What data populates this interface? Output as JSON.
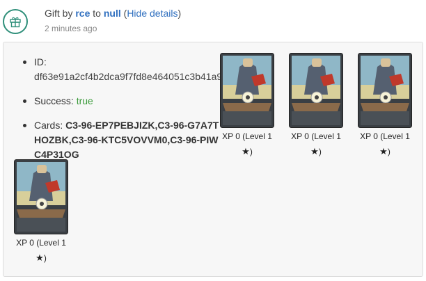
{
  "header": {
    "prefix": "Gift by",
    "sender": "rce",
    "to_word": "to",
    "recipient": "null",
    "open_paren": "(",
    "hide_details": "Hide details",
    "close_paren": ")",
    "timestamp": "2 minutes ago",
    "icon": "gift-icon"
  },
  "details": {
    "id_label": "ID:",
    "id_value": "df63e91a2cf4b2dca9f7fd8e464051c3b41a9",
    "success_label": "Success:",
    "success_value": "true",
    "cards_label": "Cards:",
    "cards_value": "C3-96-EP7PEBJIZK,C3-96-G7A7THOZBK,C3-96-KTC5VOVVM0,C3-96-PIWC4P31OG"
  },
  "cards": [
    {
      "xp_text": "XP 0 (Level 1",
      "star": "★",
      "close": ")"
    },
    {
      "xp_text": "XP 0 (Level 1",
      "star": "★",
      "close": ")"
    },
    {
      "xp_text": "XP 0 (Level 1",
      "star": "★",
      "close": ")"
    },
    {
      "xp_text": "XP 0 (Level 1",
      "star": "★",
      "close": ")"
    }
  ],
  "colors": {
    "accent_teal": "#2f8f7a",
    "link_blue": "#2f6fbf",
    "success_green": "#3d9c3d"
  }
}
